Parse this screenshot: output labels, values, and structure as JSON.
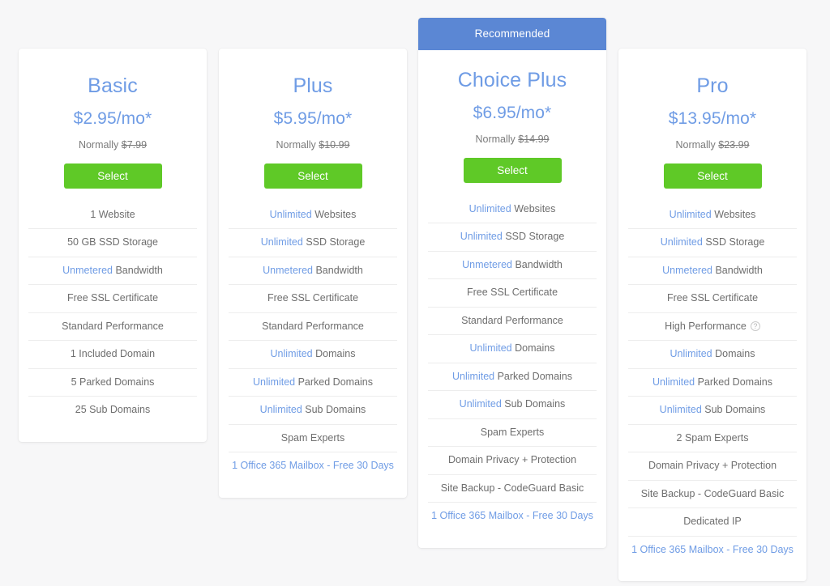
{
  "page": {
    "background_color": "#f7f7f8",
    "accent_blue": "#6f9ce5",
    "banner_blue": "#5b87d4",
    "button_green": "#5fc927",
    "text_gray": "#6e6e6e",
    "divider_color": "#ededed"
  },
  "plans": [
    {
      "name": "Basic",
      "price": "$2.95/mo*",
      "normally_label": "Normally",
      "normally_price": "$7.99",
      "select_label": "Select",
      "recommended": false,
      "recommended_label": "",
      "features": [
        {
          "highlight": "",
          "text": "1 Website",
          "link": false,
          "info": false
        },
        {
          "highlight": "",
          "text": "50 GB SSD Storage",
          "link": false,
          "info": false
        },
        {
          "highlight": "Unmetered",
          "text": "Bandwidth",
          "link": false,
          "info": false
        },
        {
          "highlight": "",
          "text": "Free SSL Certificate",
          "link": false,
          "info": false
        },
        {
          "highlight": "",
          "text": "Standard Performance",
          "link": false,
          "info": false
        },
        {
          "highlight": "",
          "text": "1 Included Domain",
          "link": false,
          "info": false
        },
        {
          "highlight": "",
          "text": "5 Parked Domains",
          "link": false,
          "info": false
        },
        {
          "highlight": "",
          "text": "25 Sub Domains",
          "link": false,
          "info": false
        }
      ]
    },
    {
      "name": "Plus",
      "price": "$5.95/mo*",
      "normally_label": "Normally",
      "normally_price": "$10.99",
      "select_label": "Select",
      "recommended": false,
      "recommended_label": "",
      "features": [
        {
          "highlight": "Unlimited",
          "text": "Websites",
          "link": false,
          "info": false
        },
        {
          "highlight": "Unlimited",
          "text": "SSD Storage",
          "link": false,
          "info": false
        },
        {
          "highlight": "Unmetered",
          "text": "Bandwidth",
          "link": false,
          "info": false
        },
        {
          "highlight": "",
          "text": "Free SSL Certificate",
          "link": false,
          "info": false
        },
        {
          "highlight": "",
          "text": "Standard Performance",
          "link": false,
          "info": false
        },
        {
          "highlight": "Unlimited",
          "text": "Domains",
          "link": false,
          "info": false
        },
        {
          "highlight": "Unlimited",
          "text": "Parked Domains",
          "link": false,
          "info": false
        },
        {
          "highlight": "Unlimited",
          "text": "Sub Domains",
          "link": false,
          "info": false
        },
        {
          "highlight": "",
          "text": "Spam Experts",
          "link": false,
          "info": false
        },
        {
          "highlight": "",
          "text": "1 Office 365 Mailbox - Free 30 Days",
          "link": true,
          "info": false
        }
      ]
    },
    {
      "name": "Choice Plus",
      "price": "$6.95/mo*",
      "normally_label": "Normally",
      "normally_price": "$14.99",
      "select_label": "Select",
      "recommended": true,
      "recommended_label": "Recommended",
      "features": [
        {
          "highlight": "Unlimited",
          "text": "Websites",
          "link": false,
          "info": false
        },
        {
          "highlight": "Unlimited",
          "text": "SSD Storage",
          "link": false,
          "info": false
        },
        {
          "highlight": "Unmetered",
          "text": "Bandwidth",
          "link": false,
          "info": false
        },
        {
          "highlight": "",
          "text": "Free SSL Certificate",
          "link": false,
          "info": false
        },
        {
          "highlight": "",
          "text": "Standard Performance",
          "link": false,
          "info": false
        },
        {
          "highlight": "Unlimited",
          "text": "Domains",
          "link": false,
          "info": false
        },
        {
          "highlight": "Unlimited",
          "text": "Parked Domains",
          "link": false,
          "info": false
        },
        {
          "highlight": "Unlimited",
          "text": "Sub Domains",
          "link": false,
          "info": false
        },
        {
          "highlight": "",
          "text": "Spam Experts",
          "link": false,
          "info": false
        },
        {
          "highlight": "",
          "text": "Domain Privacy + Protection",
          "link": false,
          "info": false
        },
        {
          "highlight": "",
          "text": "Site Backup - CodeGuard Basic",
          "link": false,
          "info": false
        },
        {
          "highlight": "",
          "text": "1 Office 365 Mailbox - Free 30 Days",
          "link": true,
          "info": false
        }
      ]
    },
    {
      "name": "Pro",
      "price": "$13.95/mo*",
      "normally_label": "Normally",
      "normally_price": "$23.99",
      "select_label": "Select",
      "recommended": false,
      "recommended_label": "",
      "features": [
        {
          "highlight": "Unlimited",
          "text": "Websites",
          "link": false,
          "info": false
        },
        {
          "highlight": "Unlimited",
          "text": "SSD Storage",
          "link": false,
          "info": false
        },
        {
          "highlight": "Unmetered",
          "text": "Bandwidth",
          "link": false,
          "info": false
        },
        {
          "highlight": "",
          "text": "Free SSL Certificate",
          "link": false,
          "info": false
        },
        {
          "highlight": "",
          "text": "High Performance",
          "link": false,
          "info": true,
          "info_glyph": "?"
        },
        {
          "highlight": "Unlimited",
          "text": "Domains",
          "link": false,
          "info": false
        },
        {
          "highlight": "Unlimited",
          "text": "Parked Domains",
          "link": false,
          "info": false
        },
        {
          "highlight": "Unlimited",
          "text": "Sub Domains",
          "link": false,
          "info": false
        },
        {
          "highlight": "",
          "text": "2 Spam Experts",
          "link": false,
          "info": false
        },
        {
          "highlight": "",
          "text": "Domain Privacy + Protection",
          "link": false,
          "info": false
        },
        {
          "highlight": "",
          "text": "Site Backup - CodeGuard Basic",
          "link": false,
          "info": false
        },
        {
          "highlight": "",
          "text": "Dedicated IP",
          "link": false,
          "info": false
        },
        {
          "highlight": "",
          "text": "1 Office 365 Mailbox - Free 30 Days",
          "link": true,
          "info": false
        }
      ]
    }
  ]
}
